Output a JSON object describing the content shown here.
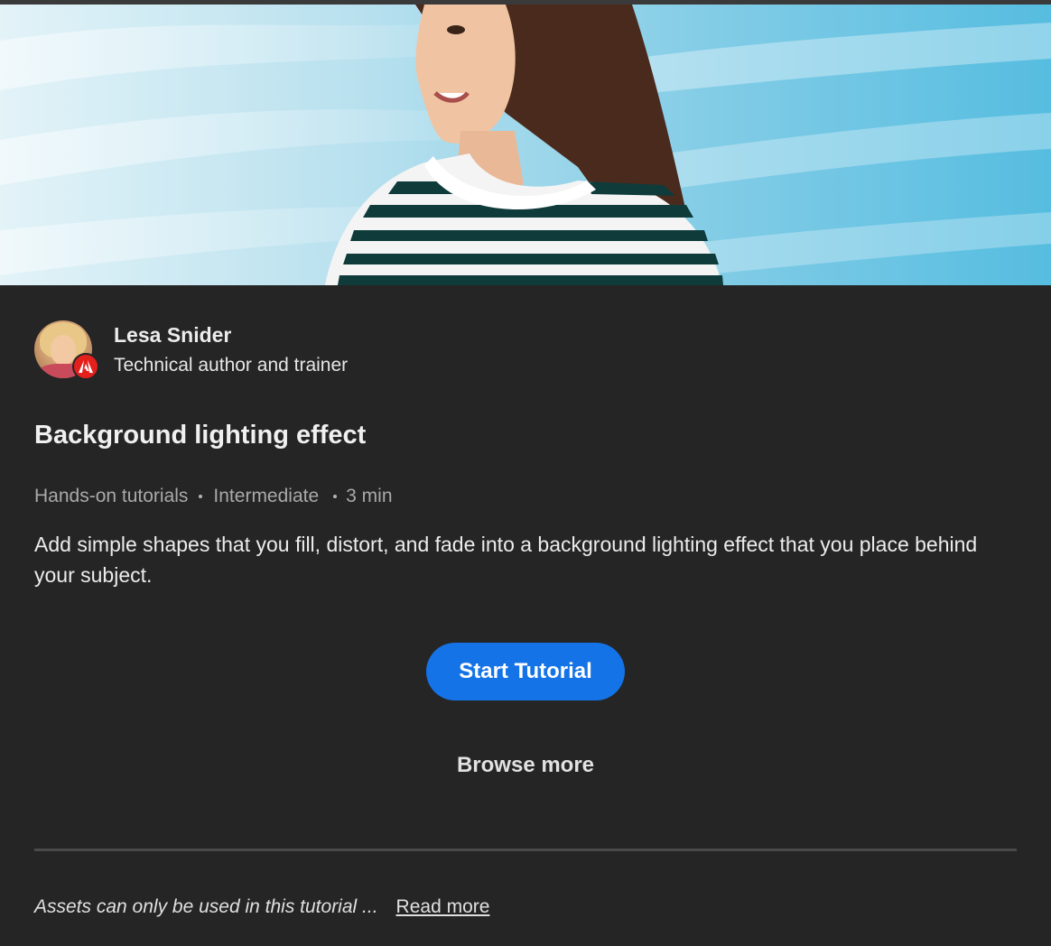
{
  "hero": {
    "image": "Girl in striped shirt against light blue background with light streaks",
    "colors": {
      "background_light": "#dff1f7",
      "background_dark": "#5bbfe0",
      "stripe": "#0f3b3b"
    }
  },
  "author": {
    "name": "Lesa Snider",
    "role": "Technical author and trainer",
    "badge_icon": "adobe-logo-icon"
  },
  "tutorial": {
    "title": "Background lighting effect",
    "meta": {
      "category": "Hands-on tutorials",
      "level": "Intermediate",
      "duration": "3 min"
    },
    "description": "Add simple shapes that you fill, distort, and fade into a background lighting effect that you place behind your subject."
  },
  "actions": {
    "start_label": "Start Tutorial",
    "browse_label": "Browse more"
  },
  "footer": {
    "assets_note": "Assets can only be used in this tutorial ...",
    "read_more_label": "Read more"
  },
  "colors": {
    "page_background": "#252525",
    "primary_button": "#1473e6",
    "adobe_red": "#e4201c"
  }
}
